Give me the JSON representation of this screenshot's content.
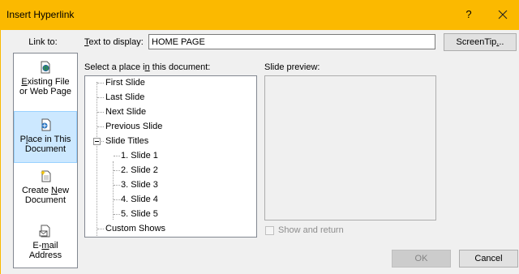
{
  "window": {
    "title": "Insert Hyperlink",
    "help_label": "?"
  },
  "link_to": {
    "label": "Link to:",
    "items": [
      {
        "line1": "Existing File",
        "line2": "or Web Page",
        "icon": "web-page-icon"
      },
      {
        "line1": "Place in This",
        "line2": "Document",
        "icon": "place-in-document-icon",
        "selected": true
      },
      {
        "line1": "Create New",
        "line2": "Document",
        "icon": "new-document-icon"
      },
      {
        "line1": "E-mail",
        "line2": "Address",
        "icon": "email-icon"
      }
    ]
  },
  "text_to_display": {
    "label": "Text to display:",
    "value": "HOME PAGE"
  },
  "screentip_label": "ScreenTip...",
  "place_label": "Select a place in this document:",
  "tree": {
    "items": [
      "First Slide",
      "Last Slide",
      "Next Slide",
      "Previous Slide",
      "Slide Titles"
    ],
    "slides": [
      "1. Slide 1",
      "2. Slide 2",
      "3. Slide 3",
      "4. Slide 4",
      "5. Slide 5"
    ],
    "custom_shows": "Custom Shows"
  },
  "preview_label": "Slide preview:",
  "show_and_return": {
    "label": "Show and return",
    "checked": false,
    "enabled": false
  },
  "buttons": {
    "ok": "OK",
    "cancel": "Cancel"
  },
  "colors": {
    "titlebar": "#fbb900",
    "selected_item": "#cce8ff",
    "dialog_bg": "#f0f0f0"
  }
}
